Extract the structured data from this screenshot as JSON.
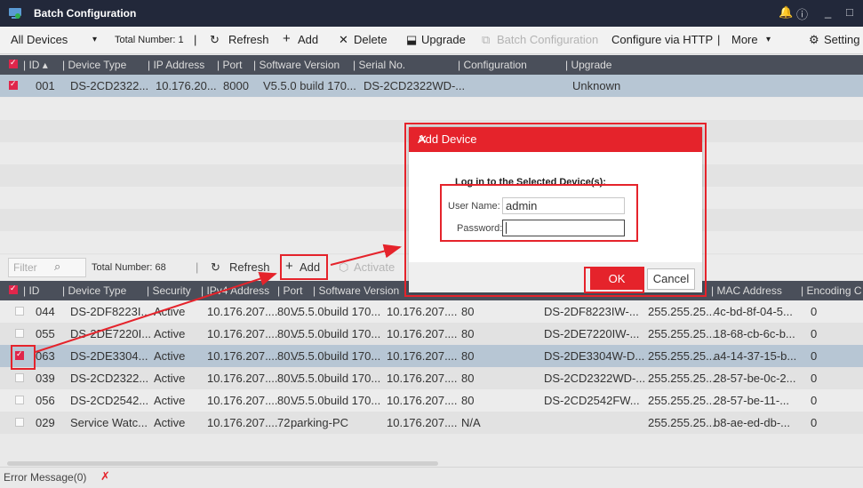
{
  "window": {
    "title": "Batch Configuration",
    "controls": [
      "🔔",
      "ⓘ",
      "_",
      "□"
    ]
  },
  "top_toolbar": {
    "filter_label": "All Devices",
    "total": "Total Number: 1",
    "refresh": "Refresh",
    "add": "Add",
    "delete": "Delete",
    "upgrade": "Upgrade",
    "batch_config": "Batch Configuration",
    "configure_http": "Configure via HTTP",
    "more": "More",
    "settings": "Setting"
  },
  "top_table": {
    "headers": [
      "ID",
      "Device Type",
      "IP Address",
      "Port",
      "Software Version",
      "Serial No.",
      "Configuration",
      "Upgrade"
    ],
    "rows": [
      {
        "id": "001",
        "type": "DS-2CD2322...",
        "ip": "10.176.20...",
        "port": "8000",
        "version": "V5.5.0 build 170...",
        "serial": "DS-2CD2322WD-...",
        "config": "",
        "upgrade": "Unknown"
      }
    ]
  },
  "bottom_toolbar": {
    "filter_placeholder": "Filter",
    "total": "Total Number: 68",
    "refresh": "Refresh",
    "add": "Add",
    "activate": "Activate"
  },
  "bottom_table": {
    "headers": [
      "ID",
      "Device Type",
      "Security",
      "IPv4 Address",
      "Port",
      "Software Version",
      "MAC Address",
      "Encoding C"
    ],
    "rows": [
      {
        "id": "044",
        "type": "DS-2DF8223I...",
        "security": "Active",
        "ip": "10.176.207....",
        "port": "80...",
        "version": "V5.5.0build 170...",
        "ip2": "10.176.207....",
        "port2": "80",
        "serial": "DS-2DF8223IW-...",
        "mask": "255.255.25...",
        "mac": "4c-bd-8f-04-5...",
        "enc": "0",
        "checked": false
      },
      {
        "id": "055",
        "type": "DS-2DE7220I...",
        "security": "Active",
        "ip": "10.176.207....",
        "port": "80...",
        "version": "V5.5.0build 170...",
        "ip2": "10.176.207....",
        "port2": "80",
        "serial": "DS-2DE7220IW-...",
        "mask": "255.255.25...",
        "mac": "18-68-cb-6c-b...",
        "enc": "0",
        "checked": false
      },
      {
        "id": "063",
        "type": "DS-2DE3304...",
        "security": "Active",
        "ip": "10.176.207....",
        "port": "80...",
        "version": "V5.5.0build 170...",
        "ip2": "10.176.207....",
        "port2": "80",
        "serial": "DS-2DE3304W-D...",
        "mask": "255.255.25...",
        "mac": "a4-14-37-15-b...",
        "enc": "0",
        "checked": true
      },
      {
        "id": "039",
        "type": "DS-2CD2322...",
        "security": "Active",
        "ip": "10.176.207....",
        "port": "80...",
        "version": "V5.5.0build 170...",
        "ip2": "10.176.207....",
        "port2": "80",
        "serial": "DS-2CD2322WD-...",
        "mask": "255.255.25...",
        "mac": "28-57-be-0c-2...",
        "enc": "0",
        "checked": false
      },
      {
        "id": "056",
        "type": "DS-2CD2542...",
        "security": "Active",
        "ip": "10.176.207....",
        "port": "80...",
        "version": "V5.5.0build 170...",
        "ip2": "10.176.207....",
        "port2": "80",
        "serial": "DS-2CD2542FW...",
        "mask": "255.255.25...",
        "mac": "28-57-be-11-...",
        "enc": "0",
        "checked": false
      },
      {
        "id": "029",
        "type": "Service Watc...",
        "security": "Active",
        "ip": "10.176.207....",
        "port": "72...",
        "version": "parking-PC",
        "ip2": "10.176.207....",
        "port2": "N/A",
        "serial": "",
        "mask": "255.255.25...",
        "mac": "b8-ae-ed-db-...",
        "enc": "0",
        "checked": false
      }
    ]
  },
  "dialog": {
    "title": "Add Device",
    "subtitle": "Log in to the Selected Device(s):",
    "username_label": "User Name:",
    "username_value": "admin",
    "password_label": "Password:",
    "password_value": "",
    "ok": "OK",
    "cancel": "Cancel"
  },
  "status": {
    "error_message": "Error Message(0)"
  },
  "colors": {
    "accent": "#e5232b",
    "selected_row": "#b7c6d4",
    "header": "#4a4f5a",
    "titlebar": "#22283a"
  }
}
